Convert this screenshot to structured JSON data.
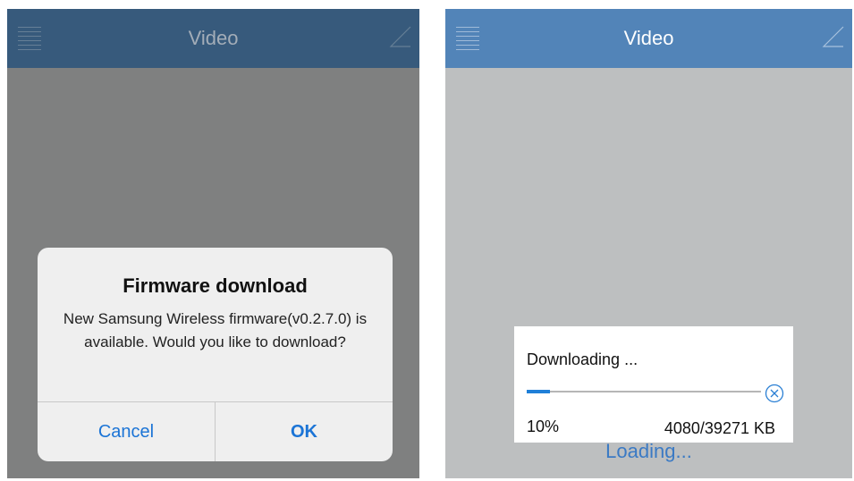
{
  "left_screen": {
    "nav_title": "Video",
    "alert": {
      "title": "Firmware download",
      "message": "New Samsung Wireless firmware(v0.2.7.0) is available. Would you like to download?",
      "cancel_label": "Cancel",
      "ok_label": "OK"
    }
  },
  "right_screen": {
    "nav_title": "Video",
    "download": {
      "title": "Downloading ...",
      "progress": 0.1,
      "percent_label": "10%",
      "size_label": "4080/39271 KB"
    },
    "loading_label": "Loading..."
  },
  "icons": {
    "menu": "menu-icon",
    "corner": "triangle-icon",
    "cancel_download": "circle-x-icon"
  },
  "colors": {
    "left_navbar": "#375a7c",
    "right_navbar": "#5284b8",
    "accent_blue": "#1b74d6",
    "progress_fill": "#1f7fd8"
  }
}
